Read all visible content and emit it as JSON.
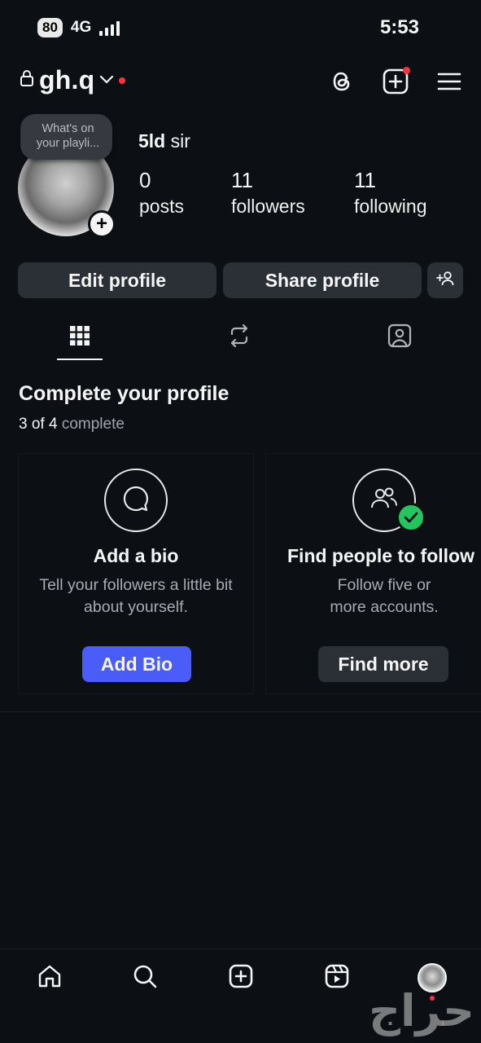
{
  "status_bar": {
    "battery": "80",
    "network": "4G",
    "time": "5:53"
  },
  "header": {
    "username": "gh.q",
    "icons": [
      "lock-icon",
      "chevron-down-icon",
      "threads-icon",
      "create-post-icon",
      "menu-icon"
    ],
    "notification_dot_color": "#ff3040"
  },
  "profile": {
    "note": "What's on your playli...",
    "display_name_bold": "5ld",
    "display_name_rest": " sir",
    "stats": [
      {
        "value": "0",
        "label": "posts"
      },
      {
        "value": "11",
        "label": "followers"
      },
      {
        "value": "11",
        "label": "following"
      }
    ]
  },
  "actions": {
    "edit_profile": "Edit profile",
    "share_profile": "Share profile"
  },
  "tabs": [
    "grid-icon",
    "reposts-icon",
    "tagged-icon"
  ],
  "complete_profile": {
    "title": "Complete your profile",
    "progress_done": "3 of 4",
    "progress_rest": " complete",
    "cards": [
      {
        "title": "Add a bio",
        "description": "Tell your followers a little bit about yourself.",
        "button": "Add Bio",
        "completed": false
      },
      {
        "title": "Find people to follow",
        "description": "Follow five or more accounts.",
        "button": "Find more",
        "completed": true
      }
    ]
  },
  "bottom_nav": [
    "home-icon",
    "search-icon",
    "create-icon",
    "reels-icon",
    "profile-avatar"
  ],
  "colors": {
    "background": "#0c1014",
    "button": "#2b2f36",
    "primary": "#4a5df9",
    "success": "#22c55e"
  },
  "watermark": "حراج"
}
